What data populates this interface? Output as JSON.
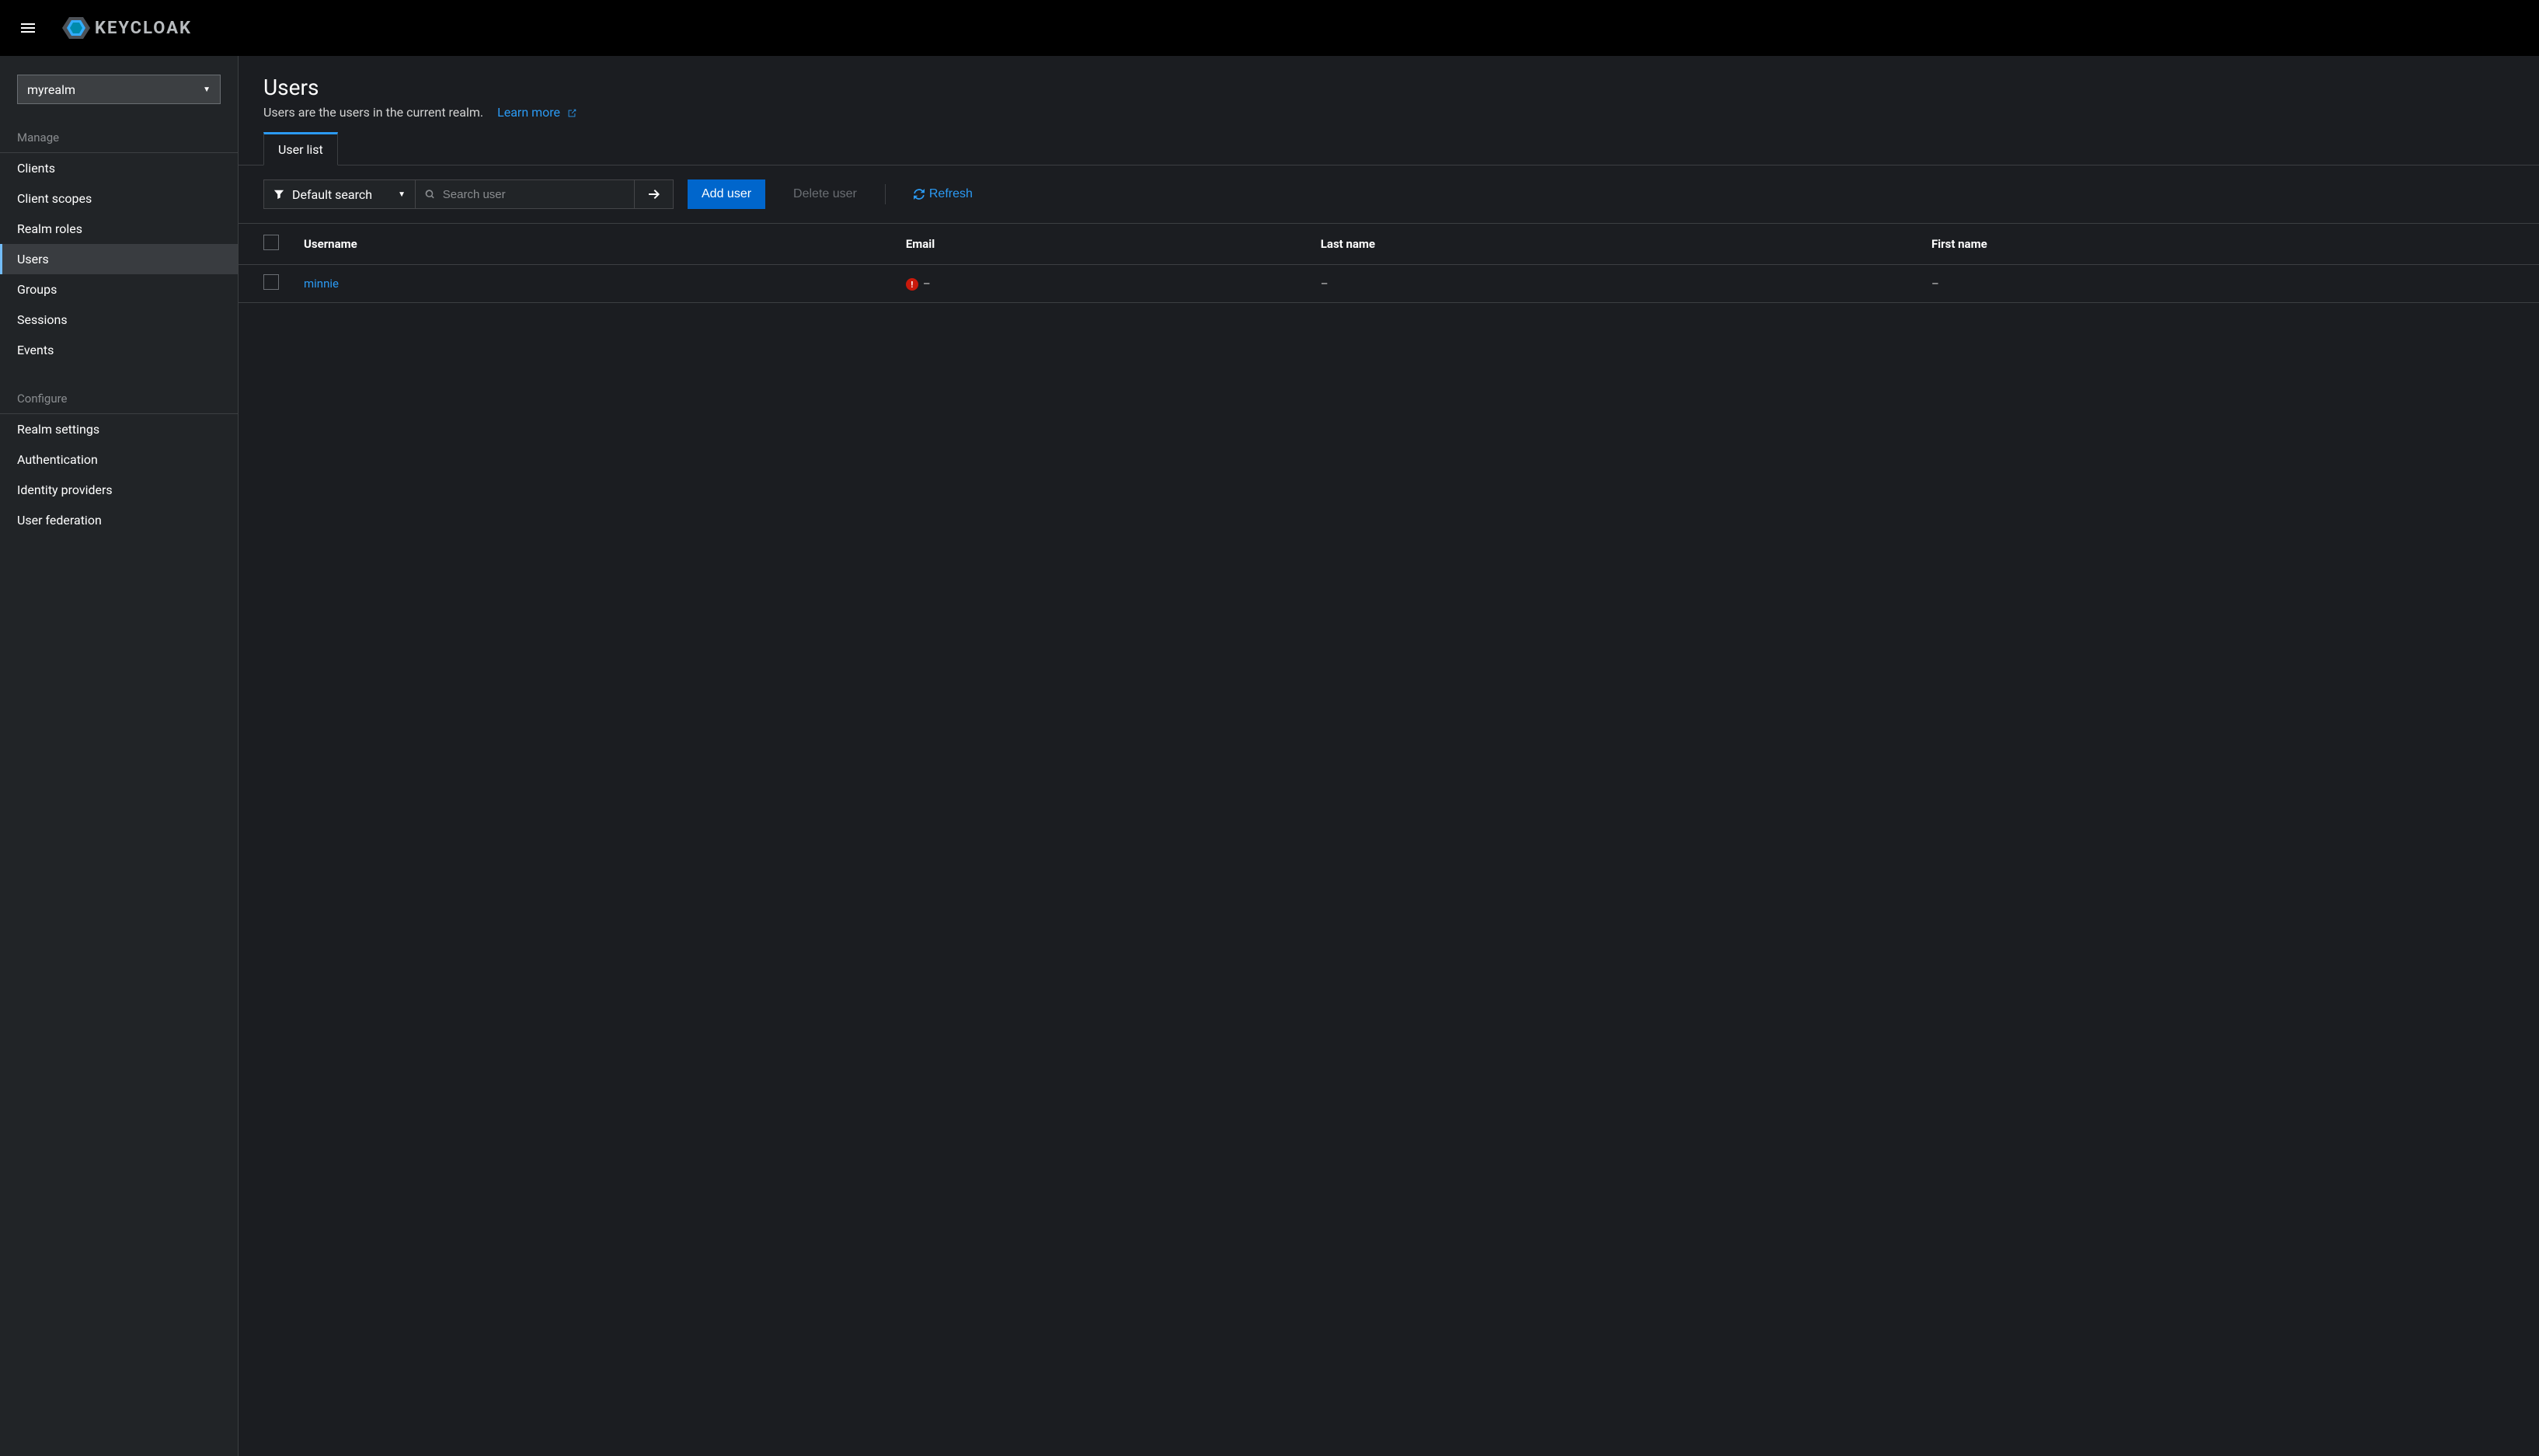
{
  "brand": "KEYCLOAK",
  "realm_selector": "myrealm",
  "sidebar": {
    "sections": [
      {
        "title": "Manage",
        "items": [
          {
            "label": "Clients",
            "active": false
          },
          {
            "label": "Client scopes",
            "active": false
          },
          {
            "label": "Realm roles",
            "active": false
          },
          {
            "label": "Users",
            "active": true
          },
          {
            "label": "Groups",
            "active": false
          },
          {
            "label": "Sessions",
            "active": false
          },
          {
            "label": "Events",
            "active": false
          }
        ]
      },
      {
        "title": "Configure",
        "items": [
          {
            "label": "Realm settings",
            "active": false
          },
          {
            "label": "Authentication",
            "active": false
          },
          {
            "label": "Identity providers",
            "active": false
          },
          {
            "label": "User federation",
            "active": false
          }
        ]
      }
    ]
  },
  "page": {
    "title": "Users",
    "description": "Users are the users in the current realm.",
    "learn_more": "Learn more"
  },
  "tabs": [
    {
      "label": "User list",
      "active": true
    }
  ],
  "toolbar": {
    "filter_label": "Default search",
    "search_placeholder": "Search user",
    "add_user": "Add user",
    "delete_user": "Delete user",
    "refresh": "Refresh"
  },
  "table": {
    "columns": [
      "Username",
      "Email",
      "Last name",
      "First name"
    ],
    "rows": [
      {
        "username": "minnie",
        "email": "–",
        "email_warning": true,
        "last_name": "–",
        "first_name": "–"
      }
    ]
  }
}
